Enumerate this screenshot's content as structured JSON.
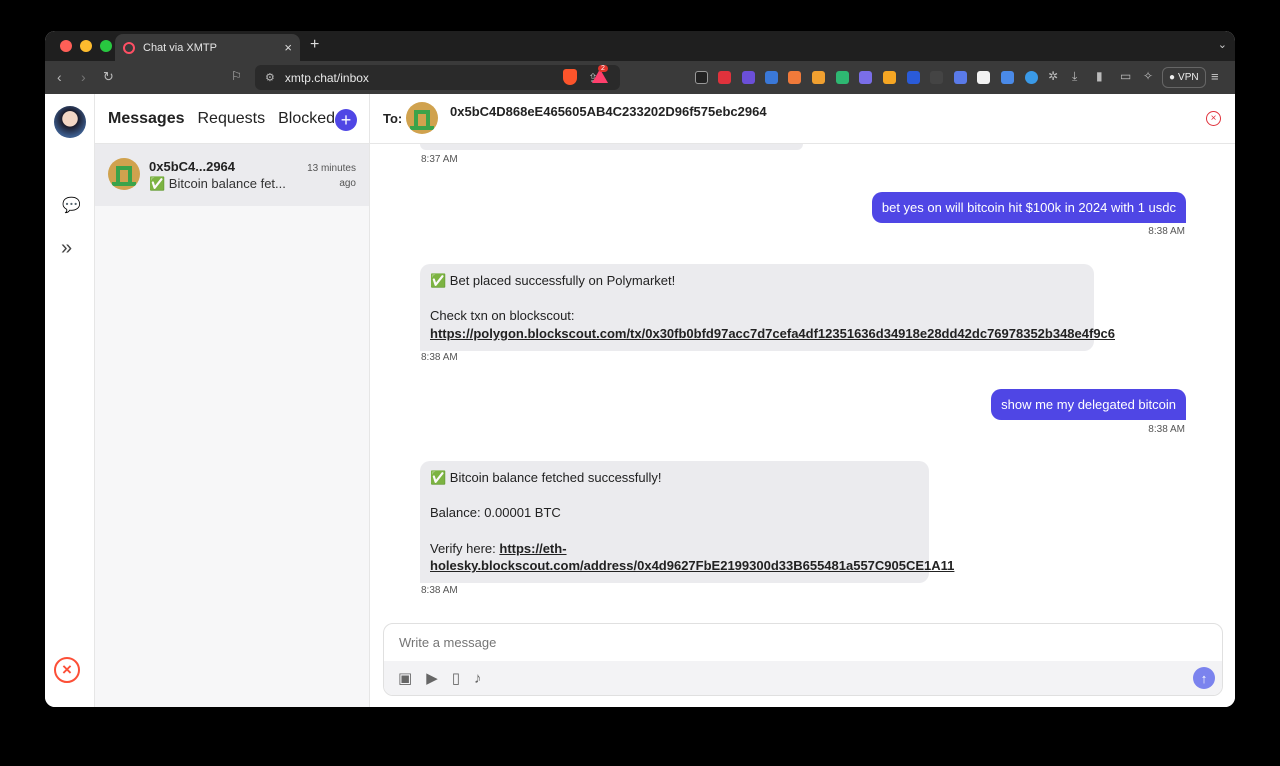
{
  "browser": {
    "tab_title": "Chat via XMTP",
    "url": "xmtp.chat/inbox",
    "bat_badge": "2",
    "vpn_label": "VPN",
    "new_tab": "+",
    "tab_close": "×"
  },
  "app": {
    "tabs": [
      {
        "label": "Messages",
        "active": true
      },
      {
        "label": "Requests",
        "active": false
      },
      {
        "label": "Blocked",
        "active": false
      }
    ],
    "conversation": {
      "name": "0x5bC4...2964",
      "preview": "✅ Bitcoin balance fet...",
      "time": "13 minutes ago"
    },
    "chat": {
      "to_label": "To:",
      "address": "0x5bC4D868eE465605AB4C233202D96f575ebc2964",
      "messages": [
        {
          "dir": "in",
          "time": "8:37 AM"
        },
        {
          "dir": "out",
          "text": "bet yes on will bitcoin hit $100k in 2024 with 1 usdc",
          "time": "8:38 AM"
        },
        {
          "dir": "in",
          "line1": "✅ Bet placed successfully on Polymarket!",
          "line2": "Check txn on blockscout:",
          "link": "https://polygon.blockscout.com/tx/0x30fb0bfd97acc7d7cefa4df12351636d34918e28dd42dc76978352b348e4f9c6",
          "time": "8:38 AM"
        },
        {
          "dir": "out",
          "text": "show me my delegated bitcoin",
          "time": "8:38 AM"
        },
        {
          "dir": "in",
          "line1": "✅ Bitcoin balance fetched successfully!",
          "line2": "Balance: 0.00001 BTC",
          "line3_prefix": "Verify here: ",
          "link_part1": "https://eth-",
          "link_part2": "holesky.blockscout.com/address/0x4d9627FbE2199300d33B655481a557C905CE1A11",
          "time": "8:38 AM"
        }
      ]
    },
    "composer": {
      "placeholder": "Write a message"
    }
  }
}
